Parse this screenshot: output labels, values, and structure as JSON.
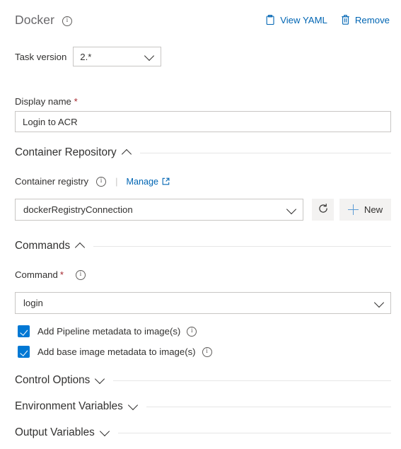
{
  "header": {
    "title": "Docker",
    "info_icon": "info-icon",
    "actions": [
      {
        "label": "View YAML",
        "icon": "clipboard-icon",
        "name": "view-yaml-button"
      },
      {
        "label": "Remove",
        "icon": "trash-icon",
        "name": "remove-button"
      }
    ]
  },
  "task_version": {
    "label": "Task version",
    "value": "2.*",
    "chevron": "chevron-down-icon"
  },
  "display_name": {
    "label": "Display name",
    "required_marker": "*",
    "value": "Login to ACR",
    "placeholder": "Display name"
  },
  "sections": {
    "container_repository": {
      "title": "Container Repository",
      "expanded": true,
      "chevron": "chevron-up-icon"
    },
    "commands": {
      "title": "Commands",
      "expanded": true,
      "chevron": "chevron-up-icon"
    },
    "control_options": {
      "title": "Control Options",
      "expanded": false,
      "chevron": "chevron-down-icon"
    },
    "environment_variables": {
      "title": "Environment Variables",
      "expanded": false,
      "chevron": "chevron-down-icon"
    },
    "output_variables": {
      "title": "Output Variables",
      "expanded": false,
      "chevron": "chevron-down-icon"
    }
  },
  "container_registry": {
    "label": "Container registry",
    "info_icon": "info-icon",
    "separator": "|",
    "manage_link": "Manage",
    "external_icon": "external-link-icon",
    "value": "dockerRegistryConnection",
    "chevron": "chevron-down-icon",
    "refresh_icon": "refresh-icon",
    "new_button": "New",
    "new_icon": "plus-icon"
  },
  "command": {
    "label": "Command",
    "required_marker": "*",
    "info_icon": "info-icon",
    "value": "login",
    "chevron": "chevron-down-icon"
  },
  "checkboxes": [
    {
      "label": "Add Pipeline metadata to image(s)",
      "checked": true,
      "info_icon": "info-icon"
    },
    {
      "label": "Add base image metadata to image(s)",
      "checked": true,
      "info_icon": "info-icon"
    }
  ],
  "colors": {
    "link": "#0065b3",
    "accent": "#0078d4",
    "required": "#a4262c",
    "border": "#c8c6c4",
    "button_bg": "#f3f2f1",
    "divider": "#e6e6e6",
    "title_gray": "#68676a",
    "plus_blue": "#5b9bd5"
  }
}
